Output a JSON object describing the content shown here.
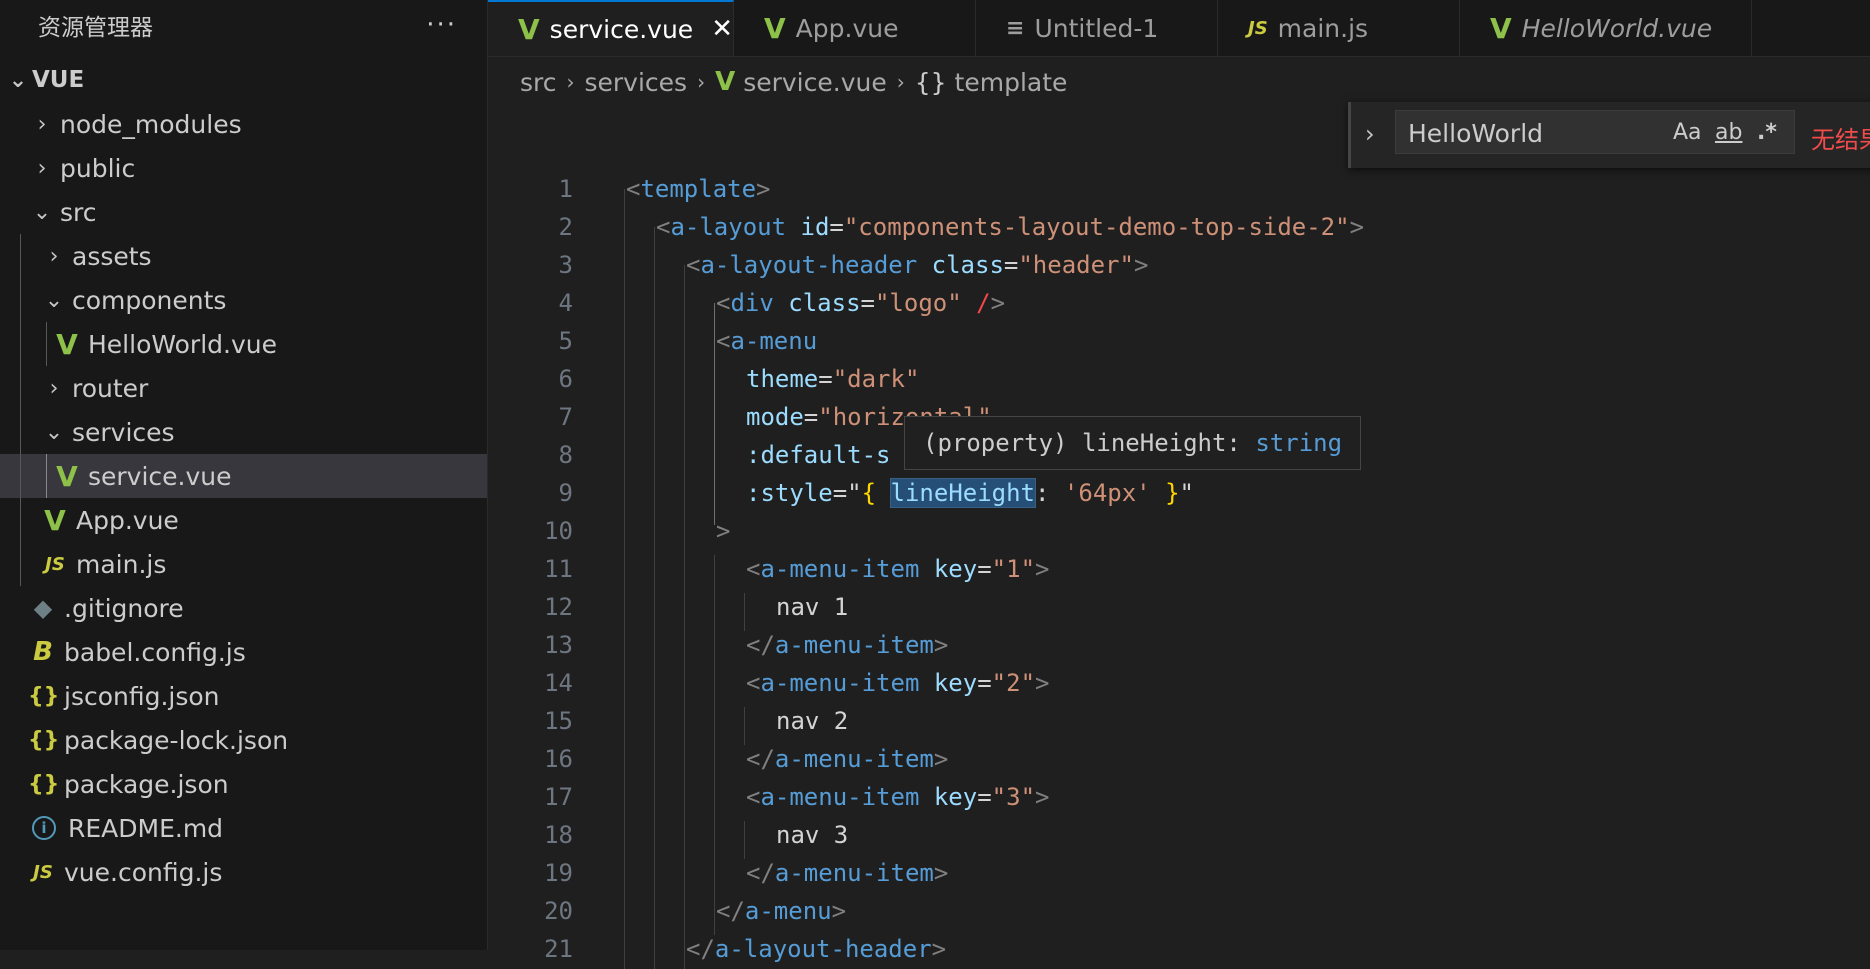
{
  "sidebar": {
    "title": "资源管理器",
    "more": "···",
    "root": "VUE",
    "items": [
      {
        "label": "node_modules",
        "type": "folder",
        "expanded": false,
        "depth": 1
      },
      {
        "label": "public",
        "type": "folder",
        "expanded": false,
        "depth": 1
      },
      {
        "label": "src",
        "type": "folder",
        "expanded": true,
        "depth": 1
      },
      {
        "label": "assets",
        "type": "folder",
        "expanded": false,
        "depth": 2
      },
      {
        "label": "components",
        "type": "folder",
        "expanded": true,
        "depth": 2
      },
      {
        "label": "HelloWorld.vue",
        "type": "vue",
        "depth": 3
      },
      {
        "label": "router",
        "type": "folder",
        "expanded": false,
        "depth": 2
      },
      {
        "label": "services",
        "type": "folder",
        "expanded": true,
        "depth": 2
      },
      {
        "label": "service.vue",
        "type": "vue",
        "depth": 3,
        "selected": true
      },
      {
        "label": "App.vue",
        "type": "vue",
        "depth": 2
      },
      {
        "label": "main.js",
        "type": "js",
        "depth": 2
      },
      {
        "label": ".gitignore",
        "type": "git",
        "depth": 1
      },
      {
        "label": "babel.config.js",
        "type": "babel",
        "depth": 1
      },
      {
        "label": "jsconfig.json",
        "type": "json",
        "depth": 1
      },
      {
        "label": "package-lock.json",
        "type": "json",
        "depth": 1
      },
      {
        "label": "package.json",
        "type": "json",
        "depth": 1
      },
      {
        "label": "README.md",
        "type": "info",
        "depth": 1
      },
      {
        "label": "vue.config.js",
        "type": "js",
        "depth": 1
      }
    ]
  },
  "tabs": [
    {
      "label": "service.vue",
      "icon": "vue-icon",
      "active": true
    },
    {
      "label": "App.vue",
      "icon": "vue-icon"
    },
    {
      "label": "Untitled-1",
      "icon": "lines-icon"
    },
    {
      "label": "main.js",
      "icon": "js-icon"
    },
    {
      "label": "HelloWorld.vue",
      "icon": "vue-icon",
      "italic": true
    }
  ],
  "breadcrumb": {
    "parts": [
      "src",
      "services",
      "service.vue",
      "template"
    ],
    "file_icon": "vue-icon",
    "symbol_icon": "{}"
  },
  "find": {
    "value": "HelloWorld",
    "match_case": "Aa",
    "whole_word": "ab",
    "regex": ".*",
    "result": "无结果"
  },
  "hover": {
    "text_prefix": "(property) lineHeight: ",
    "text_type": "string"
  },
  "icons": {
    "vue": "V",
    "js": "JS",
    "json": "{}",
    "git": "◆",
    "babel": "B",
    "info": "i",
    "chevron_right": "›",
    "chevron_down": "⌄",
    "close": "✕",
    "lines": "≡"
  },
  "code": [
    {
      "n": "1",
      "indent": 0,
      "tokens": [
        [
          "p",
          "<"
        ],
        [
          "t",
          "template"
        ],
        [
          "p",
          ">"
        ]
      ]
    },
    {
      "n": "2",
      "indent": 1,
      "tokens": [
        [
          "p",
          "<"
        ],
        [
          "t",
          "a-layout"
        ],
        [
          "x",
          " "
        ],
        [
          "a",
          "id"
        ],
        [
          "x",
          "="
        ],
        [
          "s",
          "\"components-layout-demo-top-side-2\""
        ],
        [
          "p",
          ">"
        ]
      ]
    },
    {
      "n": "3",
      "indent": 2,
      "tokens": [
        [
          "p",
          "<"
        ],
        [
          "t",
          "a-layout-header"
        ],
        [
          "x",
          " "
        ],
        [
          "a",
          "class"
        ],
        [
          "x",
          "="
        ],
        [
          "s",
          "\"header\""
        ],
        [
          "p",
          ">"
        ]
      ]
    },
    {
      "n": "4",
      "indent": 3,
      "tokens": [
        [
          "p",
          "<"
        ],
        [
          "t",
          "div"
        ],
        [
          "x",
          " "
        ],
        [
          "a",
          "class"
        ],
        [
          "x",
          "="
        ],
        [
          "s",
          "\"logo\""
        ],
        [
          "x",
          " "
        ],
        [
          "r",
          "/"
        ],
        [
          "p",
          ">"
        ]
      ]
    },
    {
      "n": "5",
      "indent": 3,
      "tokens": [
        [
          "p",
          "<"
        ],
        [
          "t",
          "a-menu"
        ]
      ]
    },
    {
      "n": "6",
      "indent": 4,
      "tokens": [
        [
          "a",
          "theme"
        ],
        [
          "x",
          "="
        ],
        [
          "s",
          "\"dark\""
        ]
      ]
    },
    {
      "n": "7",
      "indent": 4,
      "tokens": [
        [
          "a",
          "mode"
        ],
        [
          "x",
          "="
        ],
        [
          "s",
          "\"horizontal\""
        ]
      ]
    },
    {
      "n": "8",
      "indent": 4,
      "tokens": [
        [
          "a",
          ":default-s"
        ]
      ]
    },
    {
      "n": "9",
      "indent": 4,
      "tokens": [
        [
          "a",
          ":style"
        ],
        [
          "x",
          "=\""
        ],
        [
          "b",
          "{"
        ],
        [
          "x",
          " "
        ],
        [
          "h",
          "lineHeight"
        ],
        [
          "x",
          ": "
        ],
        [
          "s",
          "'64px'"
        ],
        [
          "x",
          " "
        ],
        [
          "b",
          "}"
        ],
        [
          "x",
          "\""
        ]
      ]
    },
    {
      "n": "10",
      "indent": 3,
      "tokens": [
        [
          "p",
          ">"
        ]
      ]
    },
    {
      "n": "11",
      "indent": 4,
      "tokens": [
        [
          "p",
          "<"
        ],
        [
          "t",
          "a-menu-item"
        ],
        [
          "x",
          " "
        ],
        [
          "a",
          "key"
        ],
        [
          "x",
          "="
        ],
        [
          "s",
          "\"1\""
        ],
        [
          "p",
          ">"
        ]
      ]
    },
    {
      "n": "12",
      "indent": 5,
      "tokens": [
        [
          "x",
          "nav 1"
        ]
      ]
    },
    {
      "n": "13",
      "indent": 4,
      "tokens": [
        [
          "p",
          "</"
        ],
        [
          "t",
          "a-menu-item"
        ],
        [
          "p",
          ">"
        ]
      ]
    },
    {
      "n": "14",
      "indent": 4,
      "tokens": [
        [
          "p",
          "<"
        ],
        [
          "t",
          "a-menu-item"
        ],
        [
          "x",
          " "
        ],
        [
          "a",
          "key"
        ],
        [
          "x",
          "="
        ],
        [
          "s",
          "\"2\""
        ],
        [
          "p",
          ">"
        ]
      ]
    },
    {
      "n": "15",
      "indent": 5,
      "tokens": [
        [
          "x",
          "nav 2"
        ]
      ]
    },
    {
      "n": "16",
      "indent": 4,
      "tokens": [
        [
          "p",
          "</"
        ],
        [
          "t",
          "a-menu-item"
        ],
        [
          "p",
          ">"
        ]
      ]
    },
    {
      "n": "17",
      "indent": 4,
      "tokens": [
        [
          "p",
          "<"
        ],
        [
          "t",
          "a-menu-item"
        ],
        [
          "x",
          " "
        ],
        [
          "a",
          "key"
        ],
        [
          "x",
          "="
        ],
        [
          "s",
          "\"3\""
        ],
        [
          "p",
          ">"
        ]
      ]
    },
    {
      "n": "18",
      "indent": 5,
      "tokens": [
        [
          "x",
          "nav 3"
        ]
      ]
    },
    {
      "n": "19",
      "indent": 4,
      "tokens": [
        [
          "p",
          "</"
        ],
        [
          "t",
          "a-menu-item"
        ],
        [
          "p",
          ">"
        ]
      ]
    },
    {
      "n": "20",
      "indent": 3,
      "tokens": [
        [
          "p",
          "</"
        ],
        [
          "t",
          "a-menu"
        ],
        [
          "p",
          ">"
        ]
      ]
    },
    {
      "n": "21",
      "indent": 2,
      "tokens": [
        [
          "p",
          "</"
        ],
        [
          "t",
          "a-layout-header"
        ],
        [
          "p",
          ">"
        ]
      ]
    }
  ]
}
